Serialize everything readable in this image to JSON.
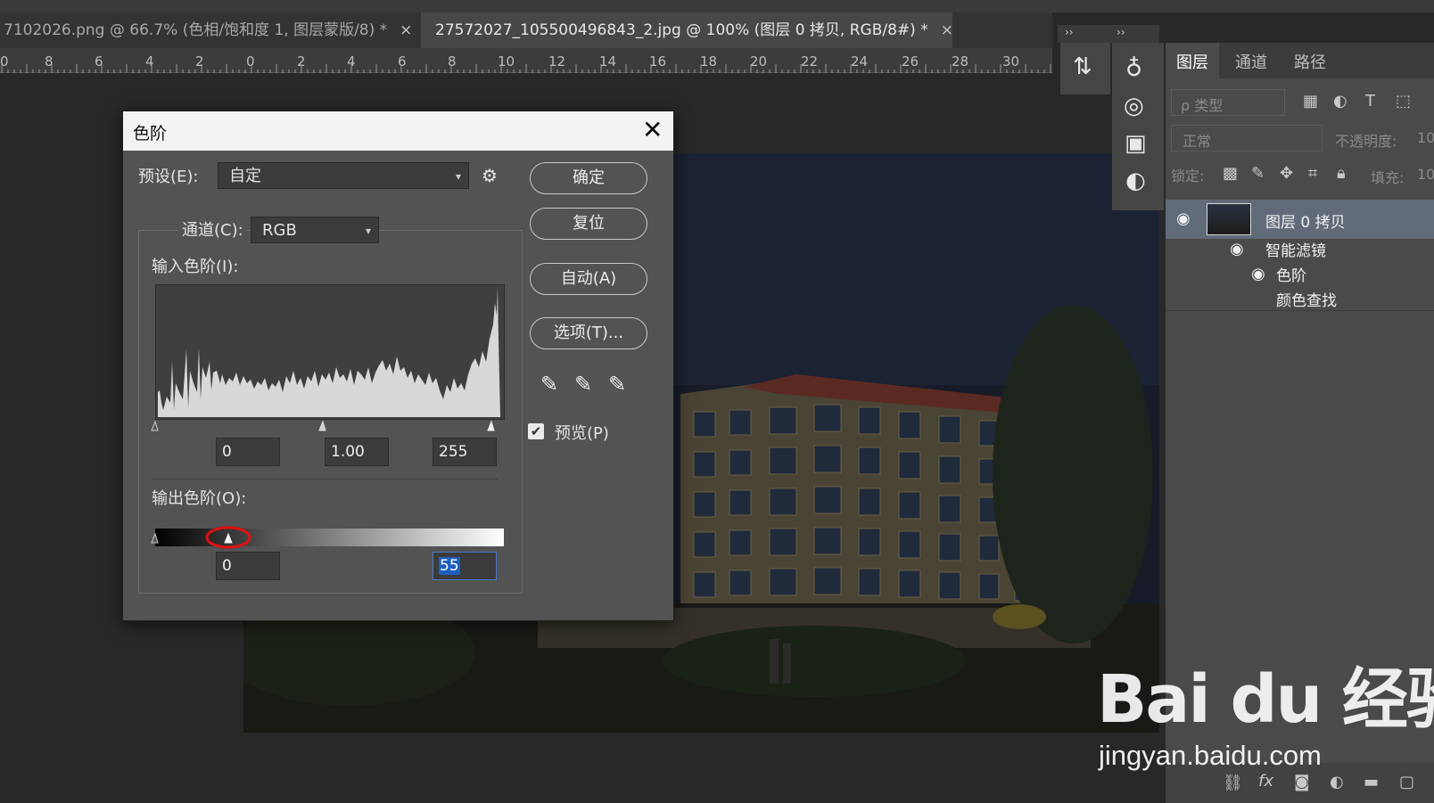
{
  "tabs": [
    {
      "title": "7102026.png @ 66.7% (色相/饱和度 1, 图层蒙版/8) *",
      "close": "×"
    },
    {
      "title": "27572027_105500496843_2.jpg @ 100% (图层 0 拷贝, RGB/8#) *",
      "close": "×"
    }
  ],
  "ruler": {
    "labels": [
      "0",
      "8",
      "6",
      "4",
      "2",
      "0",
      "2",
      "4",
      "6",
      "8",
      "10",
      "12",
      "14",
      "16",
      "18",
      "20",
      "22",
      "24",
      "26",
      "28",
      "30"
    ]
  },
  "dialog": {
    "title": "色阶",
    "close": "✕",
    "preset_label": "预设(E):",
    "preset_value": "自定",
    "channel_label": "通道(C):",
    "channel_value": "RGB",
    "input_levels_label": "输入色阶(I):",
    "input_values": {
      "black": "0",
      "gamma": "1.00",
      "white": "255"
    },
    "output_levels_label": "输出色阶(O):",
    "output_values": {
      "black": "0",
      "white": "55"
    },
    "buttons": {
      "ok": "确定",
      "reset": "复位",
      "auto": "自动(A)",
      "options": "选项(T)..."
    },
    "preview_label": "预览(P)",
    "preview_checked": true
  },
  "layers_panel": {
    "tabs": [
      "图层",
      "通道",
      "路径"
    ],
    "filter_placeholder": "ρ 类型",
    "blend_mode": "正常",
    "opacity_label": "不透明度:",
    "opacity_value": "10",
    "lock_label": "锁定:",
    "fill_label": "填充:",
    "fill_value": "10",
    "layers": [
      {
        "name": "图层 0 拷贝",
        "selected": true
      },
      {
        "name": "智能滤镜"
      },
      {
        "name": "色阶"
      },
      {
        "name": "颜色查找"
      }
    ]
  },
  "watermark": {
    "logo": "Bai du 经验",
    "url": "jingyan.baidu.com"
  },
  "colors": {
    "accent_selection": "#1d5fbf",
    "highlight_circle": "#e01010",
    "dialog_bg": "#535353"
  }
}
